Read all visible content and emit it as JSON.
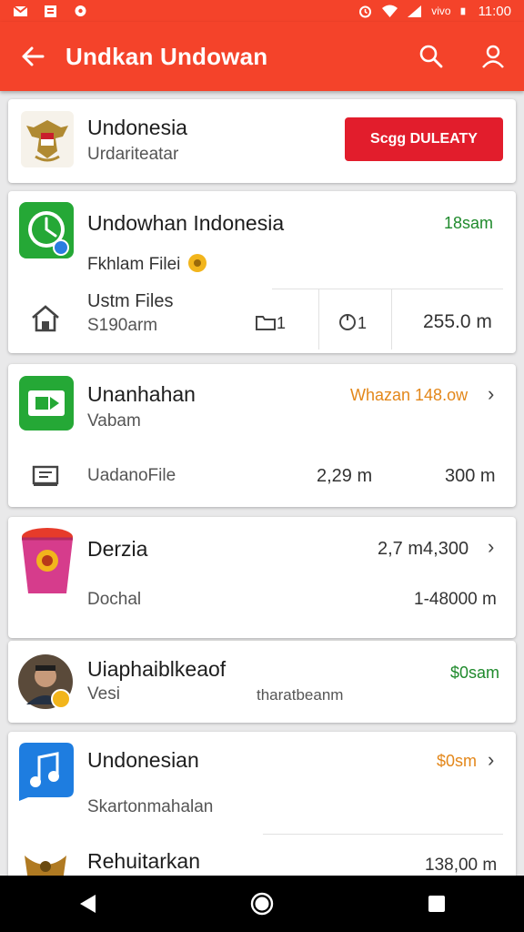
{
  "statusbar": {
    "time": "11:00",
    "carrier": "vivo"
  },
  "appbar": {
    "title": "Undkan Undowan"
  },
  "header_card": {
    "name": "Undonesia",
    "subtitle": "Urdariteatar",
    "button_label": "Scgg DULEATY"
  },
  "card1": {
    "title": "Undowhan Indonesia",
    "time": "18sam",
    "subtitle": "Fkhlam Filei",
    "files_label": "Ustm Files",
    "files_sub": "S190arm",
    "count_a": "1",
    "count_b": "1",
    "size": "255.0 m"
  },
  "card2": {
    "title": "Unanhahan",
    "link": "Whazan 148.ow",
    "subtitle": "Vabam",
    "file_label": "UadanoFile",
    "size_a": "2,29 m",
    "size_b": "300 m"
  },
  "card3": {
    "title": "Derzia",
    "price": "2,7 m4,300",
    "subtitle": "Dochal",
    "amount": "1-48000 m"
  },
  "card4": {
    "title": "Uiaphaiblkeaof",
    "amount": "$0sam",
    "subtitle": "Vesi",
    "note": "tharatbeanm"
  },
  "card5": {
    "title": "Undonesian",
    "amount": "$0sm",
    "subtitle": "Skartonmahalan"
  },
  "card6": {
    "title": "Rehuitarkan",
    "amount": "138,00 m"
  },
  "colors": {
    "brand": "#f4432a",
    "cta": "#e21d2c",
    "green": "#1f8a2c",
    "orange": "#e3871a"
  }
}
